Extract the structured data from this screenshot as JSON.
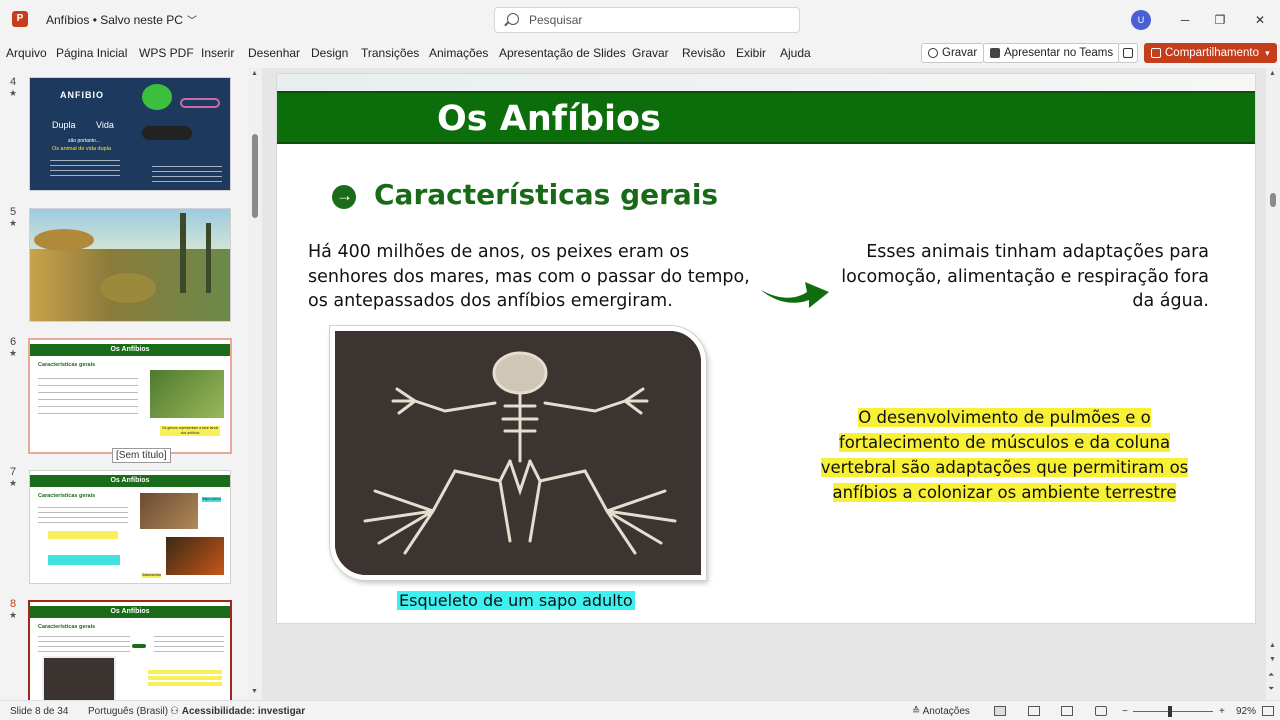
{
  "window": {
    "title": "Anfíbios • Salvo neste PC",
    "search_placeholder": "Pesquisar",
    "avatar_initial": "U",
    "minimize": "─",
    "maximize": "❐",
    "close": "✕"
  },
  "ribbon": {
    "tabs": [
      "Arquivo",
      "Página Inicial",
      "WPS PDF",
      "Inserir",
      "Desenhar",
      "Design",
      "Transições",
      "Animações",
      "Apresentação de Slides",
      "Gravar",
      "Revisão",
      "Exibir",
      "Ajuda"
    ],
    "record_label": "Gravar",
    "teams_label": "Apresentar no Teams",
    "share_label": "Compartilhamento"
  },
  "thumbnails": [
    {
      "number": "4",
      "star": "★"
    },
    {
      "number": "5",
      "star": "★"
    },
    {
      "number": "6",
      "star": "★"
    },
    {
      "number": "7",
      "star": "★"
    },
    {
      "number": "8",
      "star": "★"
    }
  ],
  "thumb_text": {
    "t4_title": "ANFIBIO",
    "t4_dupla": "Dupla",
    "t4_vida": "Vida",
    "t4_sub": "são portanto...",
    "t4_sub2": "Os animal de vida dupla",
    "t6_title": "Os Anfíbios",
    "t6_head": "Características gerais",
    "t6_hl": "Os girinos representam a fase larval dos anfíbios",
    "t7_title": "Os Anfíbios",
    "t7_head": "Características gerais",
    "t7_cy": "Sapo-cururu",
    "t7_hl": "Salamandra",
    "t8_title": "Os Anfíbios",
    "t8_head": "Características gerais"
  },
  "tooltip": "[Sem título]",
  "slide": {
    "title": "Os Anfíbios",
    "section_heading": "Características gerais",
    "left_paragraph": "Há 400 milhões de anos, os peixes eram os senhores dos mares, mas com o passar do tempo, os antepassados dos anfíbios emergiram.",
    "right_paragraph": "Esses animais tinham adaptações para locomoção, alimentação e respiração fora da água.",
    "highlight_lines": [
      "O desenvolvimento de pulmões e o",
      "fortalecimento de músculos e da coluna",
      "vertebral são adaptações que permitiram os",
      "anfíbios a colonizar os ambiente terrestre"
    ],
    "caption": "Esqueleto de um sapo adulto",
    "colors": {
      "band": "#0b6e0b",
      "heading": "#186a18",
      "highlight": "#f7f034",
      "caption_bg": "#3ff0f0"
    }
  },
  "status": {
    "slide_counter": "Slide 8 de 34",
    "language": "Português (Brasil)",
    "accessibility": "Acessibilidade: investigar",
    "notes": "Anotações",
    "zoom": "92%"
  }
}
